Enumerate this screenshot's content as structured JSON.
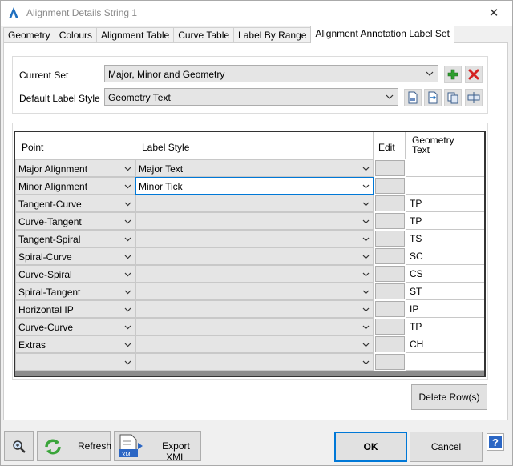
{
  "window": {
    "title": "Alignment Details String 1",
    "close_label": "✕"
  },
  "tabs": [
    {
      "label": "Geometry"
    },
    {
      "label": "Colours"
    },
    {
      "label": "Alignment Table"
    },
    {
      "label": "Curve Table"
    },
    {
      "label": "Label By Range"
    },
    {
      "label": "Alignment Annotation Label Set",
      "active": true
    }
  ],
  "settings": {
    "current_set_label": "Current Set",
    "current_set_value": "Major, Minor and Geometry",
    "default_label_style_label": "Default Label Style",
    "default_label_style_value": "Geometry Text"
  },
  "grid": {
    "columns": [
      "Point",
      "Label Style",
      "Edit",
      "Geometry\nText"
    ],
    "rows": [
      {
        "point": "Major Alignment",
        "style": "Major Text",
        "text": ""
      },
      {
        "point": "Minor Alignment",
        "style": "Minor Tick",
        "text": "",
        "selected_style": true
      },
      {
        "point": "Tangent-Curve",
        "style": "",
        "text": "TP"
      },
      {
        "point": "Curve-Tangent",
        "style": "",
        "text": "TP"
      },
      {
        "point": "Tangent-Spiral",
        "style": "",
        "text": "TS"
      },
      {
        "point": "Spiral-Curve",
        "style": "",
        "text": "SC"
      },
      {
        "point": "Curve-Spiral",
        "style": "",
        "text": "CS"
      },
      {
        "point": "Spiral-Tangent",
        "style": "",
        "text": "ST"
      },
      {
        "point": "Horizontal IP",
        "style": "",
        "text": "IP"
      },
      {
        "point": "Curve-Curve",
        "style": "",
        "text": "TP"
      },
      {
        "point": "Extras",
        "style": "",
        "text": "CH"
      },
      {
        "point": "",
        "style": "",
        "text": ""
      }
    ]
  },
  "buttons": {
    "delete_rows": "Delete Row(s)",
    "refresh": "Refresh",
    "export_xml": "Export XML",
    "export_xml_icon_text": "XML",
    "ok": "OK",
    "cancel": "Cancel",
    "help": "?"
  },
  "colors": {
    "accent": "#0078d7",
    "add_green": "#2e9e2e",
    "delete_red": "#d42020"
  }
}
